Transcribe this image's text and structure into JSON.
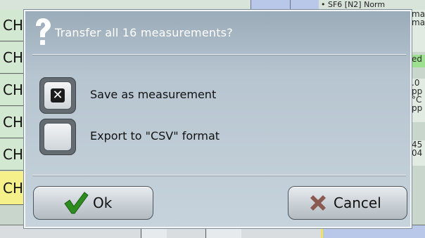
{
  "background": {
    "rows": [
      "CH",
      "CH",
      "CH",
      "CH",
      "CH",
      "CH"
    ],
    "top_fragment": "• SF6 [N2]   Norm",
    "right_fragments": [
      "ma",
      "ma",
      "ed",
      ".0",
      "pp",
      "°C",
      "pp",
      "45",
      "04"
    ]
  },
  "dialog": {
    "title": "Transfer all 16 measurements?",
    "options": [
      {
        "label": "Save as measurement",
        "checked": true,
        "mark": "✕"
      },
      {
        "label": "Export to \"CSV\" format",
        "checked": false,
        "mark": ""
      }
    ],
    "ok_label": "Ok",
    "cancel_label": "Cancel",
    "colors": {
      "ok_green": "#2e8b1f",
      "cancel_red": "#8a5a50",
      "title_text": "#ffffff"
    }
  }
}
